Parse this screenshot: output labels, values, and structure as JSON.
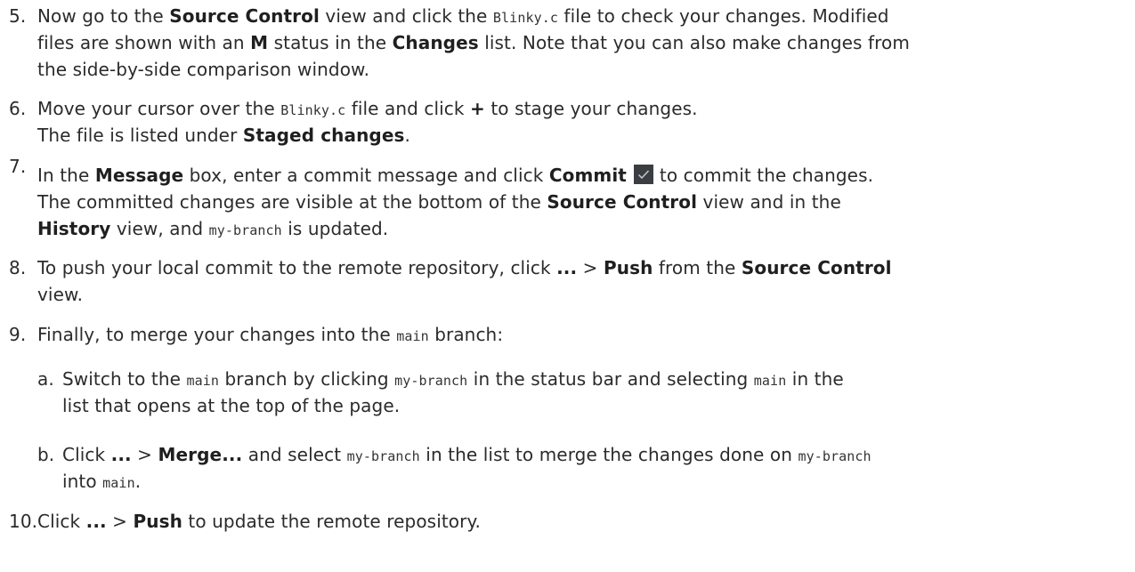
{
  "steps": [
    {
      "number": "5.",
      "lines": [
        [
          "Now go to the ",
          {
            "b": "Source Control"
          },
          " view and click the ",
          {
            "code": "Blinky.c"
          },
          " file to check your changes. Modified"
        ],
        [
          "files are shown with an ",
          {
            "b": "M"
          },
          " status in the ",
          {
            "b": "Changes"
          },
          " list. Note that you can also make changes from"
        ],
        [
          "the side-by-side comparison window."
        ]
      ]
    },
    {
      "number": "6.",
      "lines": [
        [
          "Move your cursor over the ",
          {
            "code": "Blinky.c"
          },
          " file and click ",
          {
            "b": "+"
          },
          " to stage your changes."
        ],
        [
          "The file is listed under ",
          {
            "b": "Staged changes"
          },
          "."
        ]
      ]
    },
    {
      "number": "7.",
      "lines": [
        [
          "In the ",
          {
            "b": "Message"
          },
          " box, enter a commit message and click ",
          {
            "b": "Commit"
          },
          " ",
          {
            "icon": "commit-check-icon"
          },
          " to commit the changes."
        ],
        [
          "The committed changes are visible at the bottom of the ",
          {
            "b": "Source Control"
          },
          " view and in the"
        ],
        [
          {
            "b": "History"
          },
          " view, and ",
          {
            "code": "my-branch"
          },
          " is updated."
        ]
      ]
    },
    {
      "number": "8.",
      "lines": [
        [
          "To push your local commit to the remote repository, click ",
          {
            "b": "..."
          },
          " > ",
          {
            "b": "Push"
          },
          " from the ",
          {
            "b": "Source Control"
          }
        ],
        [
          "view."
        ]
      ]
    },
    {
      "number": "9.",
      "lines": [
        [
          "Finally, to merge your changes into the ",
          {
            "code": "main"
          },
          " branch:"
        ]
      ]
    },
    {
      "number": "a.",
      "sub": true,
      "lines": [
        [
          "Switch to the ",
          {
            "code": "main"
          },
          " branch by clicking ",
          {
            "code": "my-branch"
          },
          " in the status bar and selecting ",
          {
            "code": "main"
          },
          " in the"
        ],
        [
          "list that opens at the top of the page."
        ]
      ]
    },
    {
      "number": "b.",
      "sub": true,
      "lines": [
        [
          "Click ",
          {
            "b": "..."
          },
          " > ",
          {
            "b": "Merge..."
          },
          " and select ",
          {
            "code": "my-branch"
          },
          " in the list to merge the changes done on ",
          {
            "code": "my-branch"
          }
        ],
        [
          "into ",
          {
            "code": "main"
          },
          "."
        ]
      ]
    },
    {
      "number": "10.",
      "lines": [
        [
          "Click ",
          {
            "b": "..."
          },
          " > ",
          {
            "b": "Push"
          },
          " to update the remote repository."
        ]
      ]
    }
  ]
}
